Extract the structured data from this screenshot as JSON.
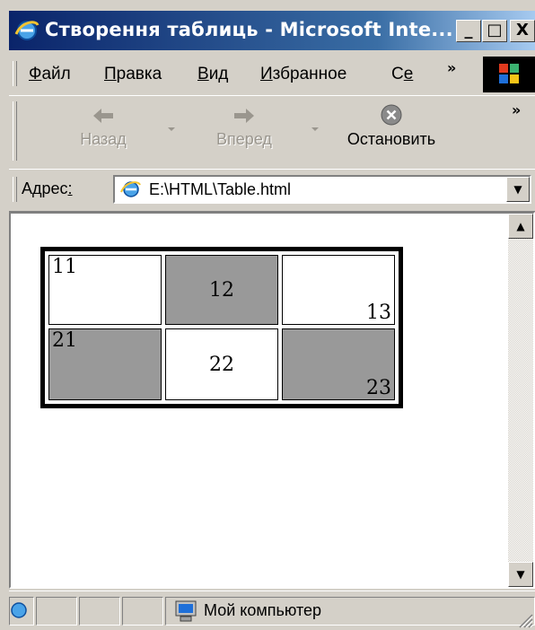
{
  "window": {
    "title": "Створення таблиць - Microsoft Inte...",
    "minimize_glyph": "_",
    "maximize_glyph": "□",
    "close_glyph": "X"
  },
  "menu": {
    "items": [
      {
        "accel": "Ф",
        "rest": "айл"
      },
      {
        "accel": "П",
        "rest": "равка"
      },
      {
        "accel": "В",
        "rest": "ид"
      },
      {
        "accel": "И",
        "rest": "збранное"
      },
      {
        "pre": "С",
        "accel": "е",
        "rest": ""
      }
    ],
    "chevron": "»"
  },
  "toolbar": {
    "back_label": "Назад",
    "forward_label": "Вперед",
    "stop_label": "Остановить",
    "chevron": "»"
  },
  "address": {
    "label": "Адрес",
    "accel": ":",
    "value": "E:\\HTML\\Table.html"
  },
  "table": {
    "rows": [
      [
        "11",
        "12",
        "13"
      ],
      [
        "21",
        "22",
        "23"
      ]
    ]
  },
  "status": {
    "zone_text": "Мой компьютер"
  },
  "colors": {
    "title_gradient_start": "#0a246a",
    "title_gradient_end": "#a6caf0",
    "chrome": "#d4d0c8",
    "shaded_cell": "#999999"
  }
}
